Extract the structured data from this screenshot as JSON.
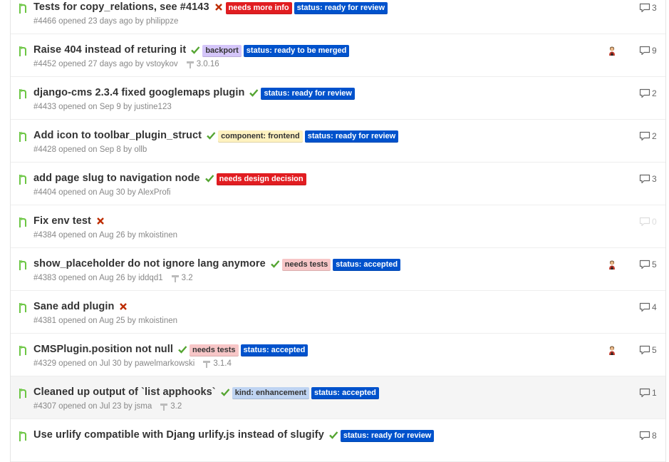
{
  "colors": {
    "pr_open": "#6cc644",
    "check_green": "#55a532",
    "cross_red": "#bd2c00",
    "label_text_dark": "#333333"
  },
  "issues": [
    {
      "title": "Tests for copy_relations, see #4143",
      "status": "failure",
      "labels": [
        {
          "text": "needs more info",
          "bg": "#e11d21",
          "fg": "#ffffff"
        },
        {
          "text": "status: ready for review",
          "bg": "#0052cc",
          "fg": "#ffffff"
        }
      ],
      "meta": "#4466 opened 23 days ago by philippze",
      "milestone": null,
      "assignee": false,
      "comments": "3"
    },
    {
      "title": "Raise 404 instead of returing it",
      "status": "success",
      "labels": [
        {
          "text": "backport",
          "bg": "#d4c5f9",
          "fg": "#333333"
        },
        {
          "text": "status: ready to be merged",
          "bg": "#0052cc",
          "fg": "#ffffff"
        }
      ],
      "meta": "#4452 opened 27 days ago by vstoykov",
      "milestone": "3.0.16",
      "assignee": true,
      "comments": "9"
    },
    {
      "title": "django-cms 2.3.4 fixed googlemaps plugin",
      "status": "success",
      "labels": [
        {
          "text": "status: ready for review",
          "bg": "#0052cc",
          "fg": "#ffffff"
        }
      ],
      "meta": "#4433 opened on Sep 9 by justine123",
      "milestone": null,
      "assignee": false,
      "comments": "2"
    },
    {
      "title": "Add icon to toolbar_plugin_struct",
      "status": "success",
      "labels": [
        {
          "text": "component: frontend",
          "bg": "#fef2c0",
          "fg": "#333333"
        },
        {
          "text": "status: ready for review",
          "bg": "#0052cc",
          "fg": "#ffffff"
        }
      ],
      "meta": "#4428 opened on Sep 8 by ollb",
      "milestone": null,
      "assignee": false,
      "comments": "2"
    },
    {
      "title": "add page slug to navigation node",
      "status": "success",
      "labels": [
        {
          "text": "needs design decision",
          "bg": "#e11d21",
          "fg": "#ffffff"
        }
      ],
      "meta": "#4404 opened on Aug 30 by AlexProfi",
      "milestone": null,
      "assignee": false,
      "comments": "3"
    },
    {
      "title": "Fix env test",
      "status": "failure",
      "labels": [],
      "meta": "#4384 opened on Aug 26 by mkoistinen",
      "milestone": null,
      "assignee": false,
      "comments": "0",
      "comments_dim": true
    },
    {
      "title": "show_placeholder do not ignore lang anymore",
      "status": "success",
      "labels": [
        {
          "text": "needs tests",
          "bg": "#f7c6c7",
          "fg": "#333333"
        },
        {
          "text": "status: accepted",
          "bg": "#0052cc",
          "fg": "#ffffff"
        }
      ],
      "meta": "#4383 opened on Aug 26 by iddqd1",
      "milestone": "3.2",
      "assignee": true,
      "comments": "5"
    },
    {
      "title": "Sane add plugin",
      "status": "failure",
      "labels": [],
      "meta": "#4381 opened on Aug 25 by mkoistinen",
      "milestone": null,
      "assignee": false,
      "comments": "4"
    },
    {
      "title": "CMSPlugin.position not null",
      "status": "success",
      "labels": [
        {
          "text": "needs tests",
          "bg": "#f7c6c7",
          "fg": "#333333"
        },
        {
          "text": "status: accepted",
          "bg": "#0052cc",
          "fg": "#ffffff"
        }
      ],
      "meta": "#4329 opened on Jul 30 by pawelmarkowski",
      "milestone": "3.1.4",
      "assignee": true,
      "comments": "5"
    },
    {
      "title": "Cleaned up output of `list apphooks`",
      "status": "success",
      "labels": [
        {
          "text": "kind: enhancement",
          "bg": "#bfd4f2",
          "fg": "#333333"
        },
        {
          "text": "status: accepted",
          "bg": "#0052cc",
          "fg": "#ffffff"
        }
      ],
      "meta": "#4307 opened on Jul 23 by jsma",
      "milestone": "3.2",
      "assignee": false,
      "comments": "1",
      "highlighted": true
    },
    {
      "title": "Use urlify compatible with Djang urlify.js instead of slugify",
      "status": "success",
      "labels": [
        {
          "text": "status: ready for review",
          "bg": "#0052cc",
          "fg": "#ffffff"
        }
      ],
      "meta": "",
      "milestone": null,
      "assignee": false,
      "comments": "8"
    }
  ]
}
